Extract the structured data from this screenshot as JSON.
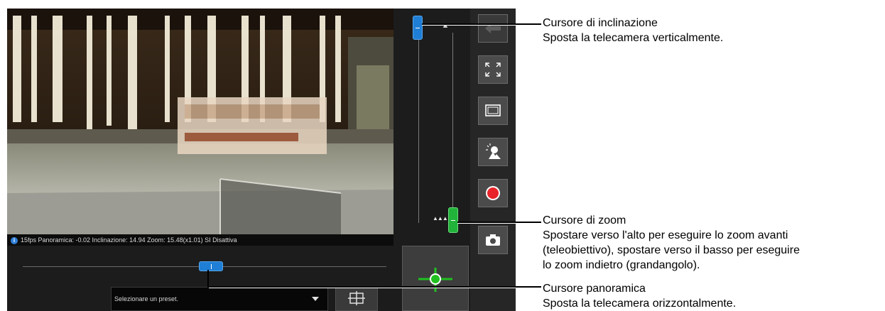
{
  "status_bar": {
    "info_icon": "info-icon",
    "text": "15fps Panoramica: -0.02 Inclinazione: 14.94 Zoom: 15.48(x1.01) SI Disattiva"
  },
  "preset": {
    "selected": "Selezionare un preset."
  },
  "sliders": {
    "tilt_level": 1.0,
    "zoom_level": 0.0,
    "pan_level": 0.5
  },
  "toolbar": {
    "buttons": [
      "back-arrow-icon",
      "fullscreen-icon",
      "screen-size-icon",
      "backlight-icon",
      "record-icon",
      "snapshot-icon"
    ]
  },
  "annotations": {
    "tilt": {
      "title": "Cursore di inclinazione",
      "desc": "Sposta la telecamera verticalmente."
    },
    "zoom": {
      "title": "Cursore di zoom",
      "line1": "Spostare verso l'alto per eseguire lo zoom avanti",
      "line2": "(teleobiettivo), spostare verso il basso per eseguire",
      "line3": "lo zoom indietro (grandangolo)."
    },
    "pan": {
      "title": "Cursore panoramica",
      "desc": "Sposta la telecamera orizzontalmente."
    }
  },
  "colors": {
    "slider_blue": "#1f7fd6",
    "slider_green": "#22b43a",
    "record_red": "#e8232a",
    "ptz_green": "#20c020"
  }
}
